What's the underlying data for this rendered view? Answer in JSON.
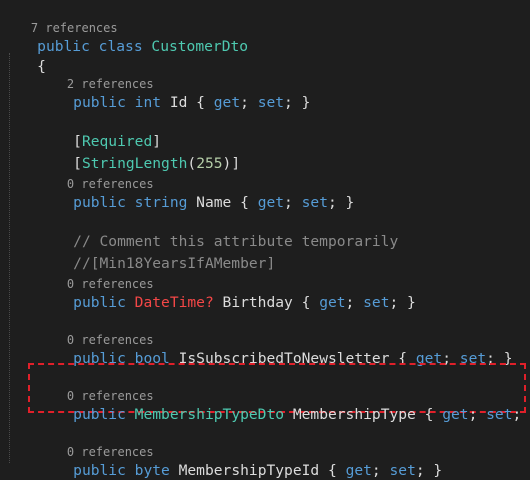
{
  "code": {
    "class_refs": "7 references",
    "class_kw_public": "public",
    "class_kw_class": "class",
    "class_name": "CustomerDto",
    "open_brace": "{",
    "close_brace": "}",
    "id_refs": "2 references",
    "id_line": {
      "public": "public",
      "type": "int",
      "name": " Id { ",
      "get": "get",
      "sep1": "; ",
      "set": "set",
      "tail": "; }"
    },
    "attr_required": {
      "open": "[",
      "name": "Required",
      "close": "]"
    },
    "attr_stringlength": {
      "open": "[",
      "name": "StringLength",
      "paren_open": "(",
      "num": "255",
      "paren_close": ")]"
    },
    "name_refs": "0 references",
    "name_line": {
      "public": "public",
      "type": "string",
      "name": " Name { ",
      "get": "get",
      "sep1": "; ",
      "set": "set",
      "tail": "; }"
    },
    "comment1": "// Comment this attribute temporarily",
    "comment2": "//[Min18YearsIfAMember]",
    "birthday_refs": "0 references",
    "birthday_line": {
      "public": "public",
      "type": "DateTime?",
      "name": " Birthday { ",
      "get": "get",
      "sep1": "; ",
      "set": "set",
      "tail": "; }"
    },
    "newsletter_refs": "0 references",
    "newsletter_line": {
      "public": "public",
      "type": "bool",
      "name": " IsSubscribedToNewsletter { ",
      "get": "get",
      "sep1": "; ",
      "set": "set",
      "tail": "; }"
    },
    "membership_refs": "0 references",
    "membership_line": {
      "public": "public",
      "type": "MembershipTypeDto",
      "name": " MembershipType { ",
      "get": "get",
      "sep1": "; ",
      "set": "set",
      "tail": "; }"
    },
    "membershipid_refs": "0 references",
    "membershipid_line": {
      "public": "public",
      "type": "byte",
      "name": " MembershipTypeId { ",
      "get": "get",
      "sep1": "; ",
      "set": "set",
      "tail": "; }"
    }
  },
  "colors": {
    "background": "#1e1e1e",
    "keyword": "#569cd6",
    "type": "#4ec9b0",
    "comment": "#8a8a8a",
    "highlight_border": "#e0202a"
  }
}
